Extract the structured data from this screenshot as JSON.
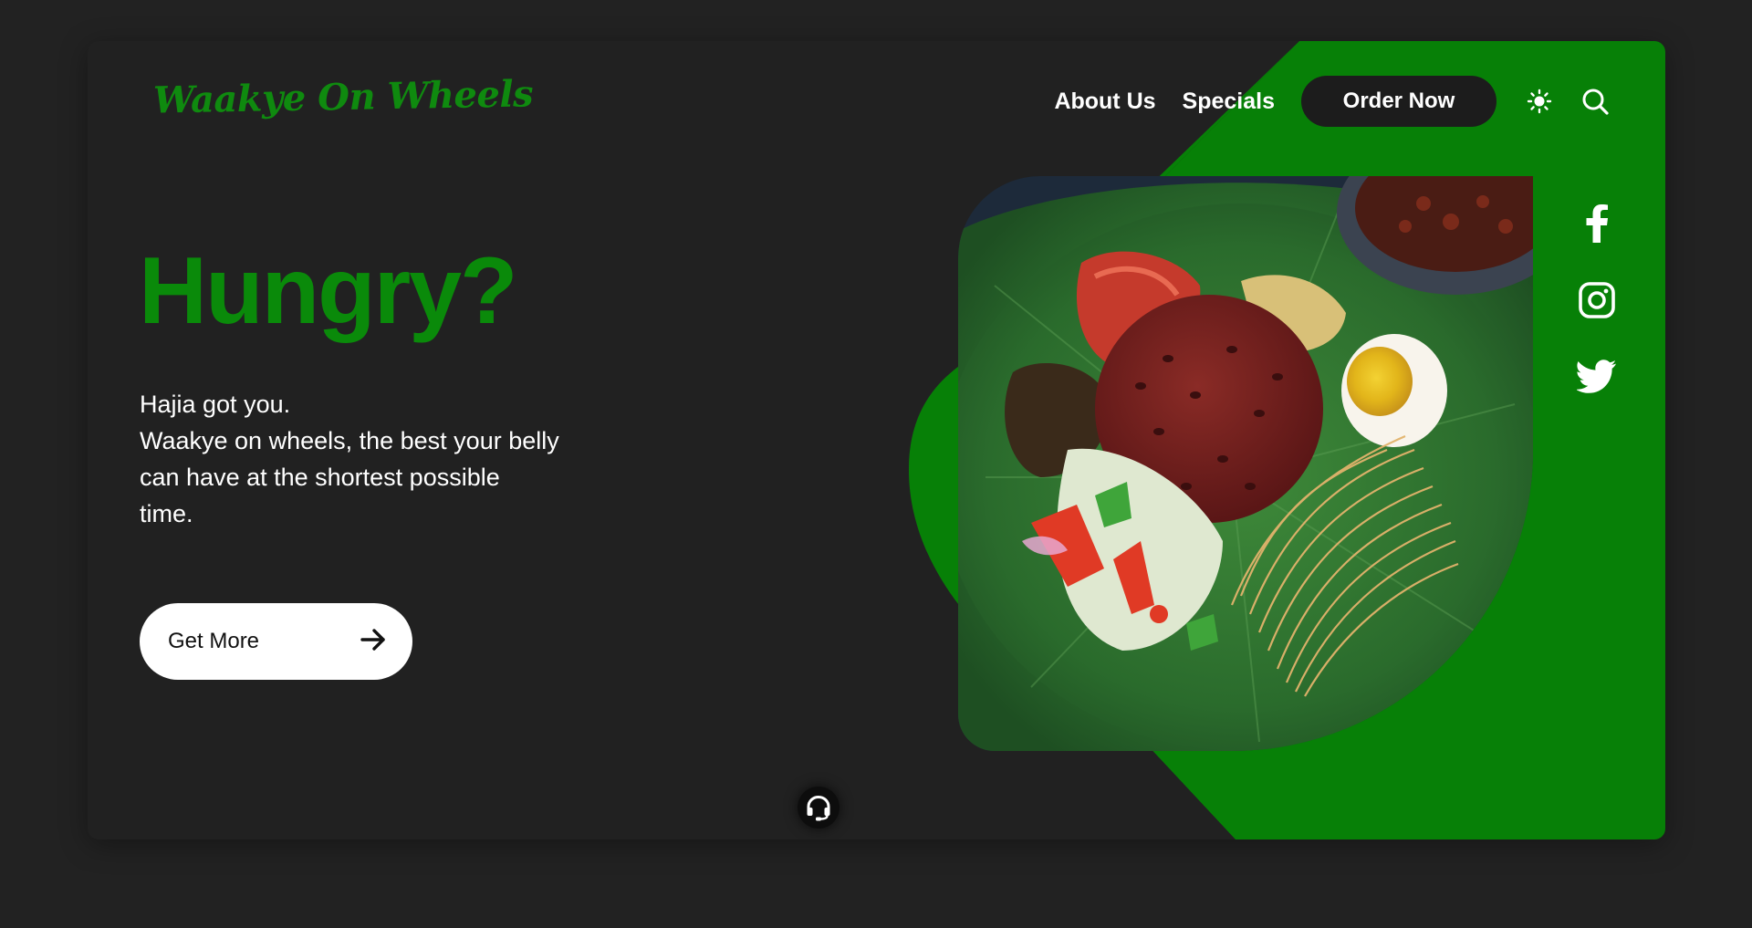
{
  "brand": {
    "logo_text": "Waakye On Wheels",
    "accent_color": "#0a8a0a"
  },
  "nav": {
    "items": [
      {
        "label": "About Us"
      },
      {
        "label": "Specials"
      }
    ],
    "order_label": "Order Now",
    "theme_icon": "sun-icon",
    "search_icon": "search-icon"
  },
  "hero": {
    "headline": "Hungry?",
    "tagline_lines": [
      "Hajia got you.",
      "Waakye on wheels, the best your belly\ncan have at the shortest possible\ntime."
    ],
    "cta_label": "Get More",
    "cta_icon": "arrow-right-icon"
  },
  "social": [
    "facebook-icon",
    "instagram-icon",
    "twitter-icon"
  ],
  "support_icon": "headset-icon",
  "colors": {
    "background": "#222222",
    "card": "#212121",
    "green": "#078007",
    "button_dark": "#1c1c1c"
  }
}
